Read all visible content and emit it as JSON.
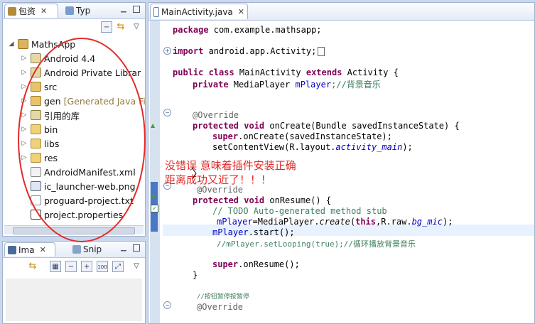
{
  "package_explorer": {
    "tab_label": "包资",
    "tab2_label": "Typ",
    "tree": [
      {
        "label": "MathsApp",
        "expanded": true,
        "level": 0
      },
      {
        "label": "Android 4.4",
        "level": 1
      },
      {
        "label": "Android Private Librar",
        "level": 1
      },
      {
        "label": "src",
        "level": 1
      },
      {
        "label": "gen",
        "note": "[Generated Java Fi",
        "level": 1
      },
      {
        "label": "引用的库",
        "level": 1
      },
      {
        "label": "bin",
        "level": 1
      },
      {
        "label": "libs",
        "level": 1
      },
      {
        "label": "res",
        "level": 1
      },
      {
        "label": "AndroidManifest.xml",
        "level": 1
      },
      {
        "label": "ic_launcher-web.png",
        "level": 1
      },
      {
        "label": "proguard-project.txt",
        "level": 1
      },
      {
        "label": "project.properties",
        "level": 1
      }
    ]
  },
  "bottom_panel": {
    "tab_label": "Ima",
    "tab2_label": "Snip"
  },
  "editor": {
    "tab_label": "MainActivity.java",
    "lines": {
      "l1": "package com.example.mathsapp;",
      "l2a": "import ",
      "l2b": "android.app.Activity;",
      "l3a": "public class ",
      "l3b": "MainActivity ",
      "l3c": "extends ",
      "l3d": "Activity {",
      "l4a": "private ",
      "l4b": "MediaPlayer ",
      "l4c": "mPlayer",
      "l4d": ";//背景音乐",
      "l5": "@Override",
      "l6a": "protected void ",
      "l6b": "onCreate(Bundle savedInstanceState) {",
      "l7a": "super",
      "l7b": ".onCreate(savedInstanceState);",
      "l8a": "setContentView(R.layout.",
      "l8b": "activity_main",
      "l8c": ");",
      "l9": "@Override",
      "l10a": "protected void ",
      "l10b": "onResume() {",
      "l11": "// TODO Auto-generated method stub",
      "l12a": "mPlayer",
      "l12b": "=MediaPlayer.",
      "l12c": "create",
      "l12d": "(",
      "l12e": "this",
      "l12f": ",R.raw.",
      "l12g": "bg_mic",
      "l12h": ");",
      "l13a": "mPlayer",
      "l13b": ".start();",
      "l14": "//mPlayer.setLooping(true);//循环播放背景音乐",
      "l15a": "super",
      "l15b": ".onResume();",
      "l16": "}",
      "l17": "//按钮暂停按暂停",
      "l18": "@Override"
    }
  },
  "annotation": {
    "line1": "没错误 意味着插件安装正确",
    "line2": "距离成功又近了！！！",
    "color": "#e22a2a"
  }
}
